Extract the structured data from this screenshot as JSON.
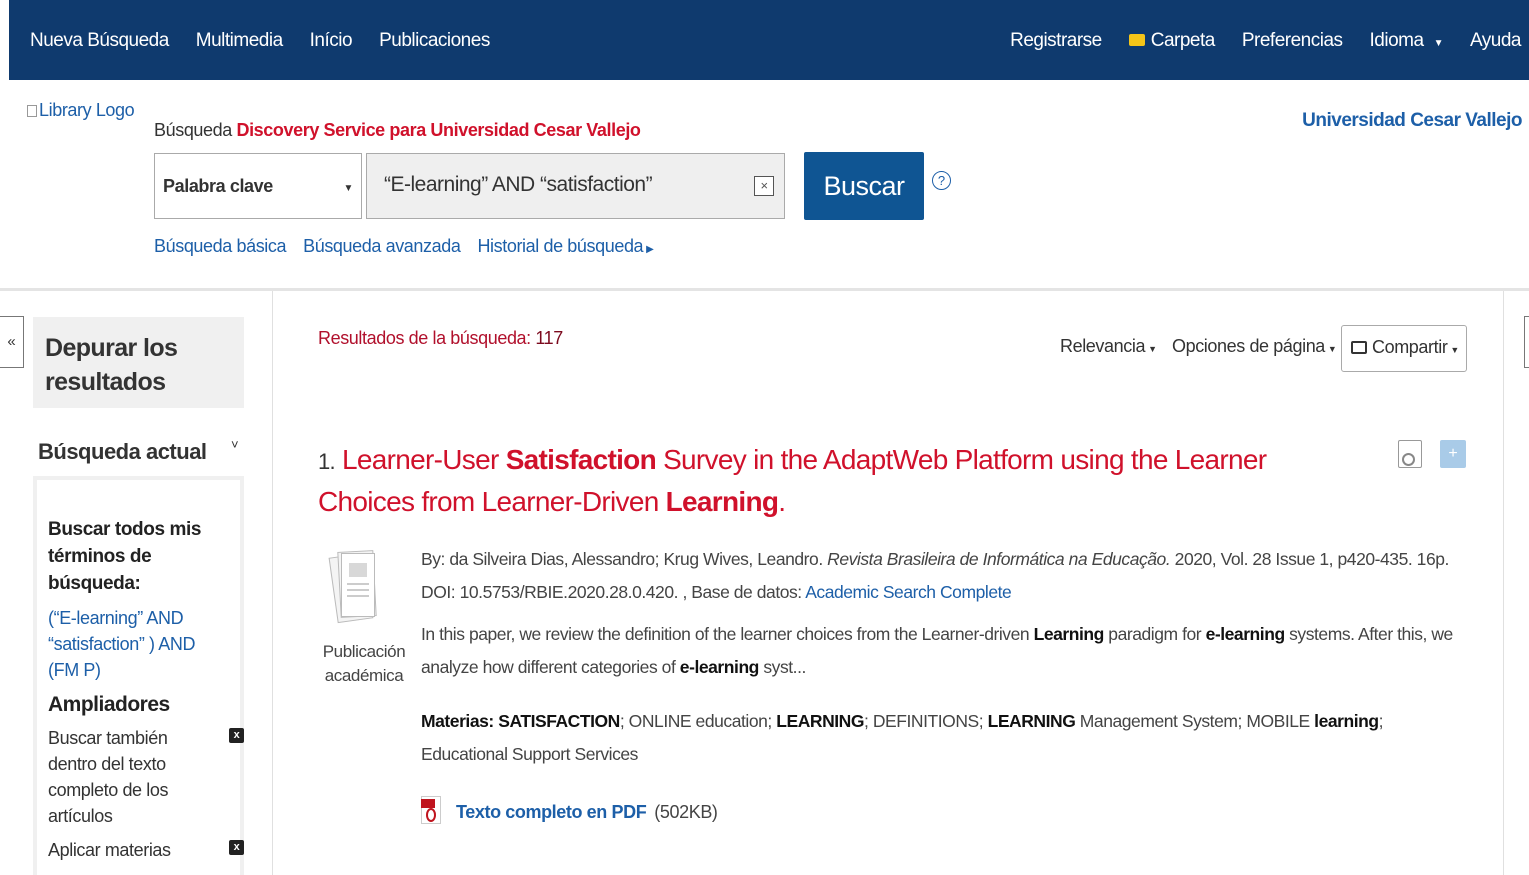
{
  "topnav": {
    "left": [
      "Nueva Búsqueda",
      "Multimedia",
      "Início",
      "Publicaciones"
    ],
    "register": "Registrarse",
    "folder": "Carpeta",
    "preferences": "Preferencias",
    "language": "Idioma",
    "help": "Ayuda"
  },
  "header": {
    "logo_alt": "Library Logo",
    "search_prefix": "Búsqueda",
    "search_service": "Discovery Service para Universidad Cesar Vallejo",
    "institution": "Universidad Cesar Vallejo",
    "field_select": "Palabra clave",
    "query": "“E-learning” AND “satisfaction”",
    "clear_icon": "×",
    "search_button": "Buscar",
    "help_icon": "?",
    "links": [
      "Búsqueda básica",
      "Búsqueda avanzada",
      "Historial de búsqueda"
    ]
  },
  "sidebar": {
    "collapse": "«",
    "refine_title": "Depurar los resultados",
    "current_search": "Búsqueda actual",
    "all_terms_heading": "Buscar todos mis términos de búsqueda:",
    "query_link": "(“E-learning” AND “satisfaction” ) AND (FM P)",
    "expanders_heading": "Ampliadores",
    "expanders": [
      {
        "label": "Buscar también dentro del texto completo de los artículos",
        "remove": "x"
      },
      {
        "label": "Aplicar materias",
        "remove": "x"
      }
    ]
  },
  "results": {
    "count_label": "Resultados de la búsqueda:",
    "count": "117",
    "sort": "Relevancia",
    "page_options": "Opciones de página",
    "share": "Compartir",
    "item": {
      "number": "1.",
      "title_parts": [
        {
          "text": "Learner-User ",
          "bold": false
        },
        {
          "text": "Satisfaction",
          "bold": true
        },
        {
          "text": " Survey in the AdaptWeb Platform using the Learner Choices from Learner-Driven ",
          "bold": false
        },
        {
          "text": "Learning",
          "bold": true
        },
        {
          "text": ".",
          "bold": false
        }
      ],
      "pub_type": "Publicación académica",
      "byline": "By: da Silveira Dias, Alessandro; Krug Wives, Leandro.",
      "journal": "Revista Brasileira de Informática na Educação.",
      "details": "2020, Vol. 28 Issue 1, p420-435. 16p. DOI: 10.5753/RBIE.2020.28.0.420. , Base de datos:",
      "database": "Academic Search Complete",
      "abstract_parts": [
        {
          "text": "In this paper, we review the definition of the learner choices from the Learner-driven ",
          "bold": false
        },
        {
          "text": "Learning",
          "bold": true
        },
        {
          "text": " paradigm for ",
          "bold": false
        },
        {
          "text": "e-learning",
          "bold": true
        },
        {
          "text": " systems. After this, we analyze how different categories of ",
          "bold": false
        },
        {
          "text": "e-learning",
          "bold": true
        },
        {
          "text": " syst...",
          "bold": false
        }
      ],
      "subjects_label": "Materias:",
      "subjects_parts": [
        {
          "text": "SATISFACTION",
          "bold": true
        },
        {
          "text": "; ONLINE education; ",
          "bold": false
        },
        {
          "text": "LEARNING",
          "bold": true
        },
        {
          "text": "; DEFINITIONS; ",
          "bold": false
        },
        {
          "text": "LEARNING",
          "bold": true
        },
        {
          "text": " Management System; MOBILE ",
          "bold": false
        },
        {
          "text": "learning",
          "bold": true
        },
        {
          "text": "; Educational Support Services",
          "bold": false
        }
      ],
      "pdf_label": "Texto completo en PDF",
      "pdf_size": "(502KB)"
    }
  },
  "colors": {
    "nav_bg": "#0f3a6e",
    "title_red": "#d0112b",
    "link_blue": "#1d5fa8",
    "button_blue": "#0f5593"
  },
  "icons": [
    "folder-icon",
    "dropdown-caret-icon",
    "clear-icon",
    "help-icon",
    "collapse-icon",
    "chevron-down-icon",
    "remove-icon",
    "share-icon",
    "preview-icon",
    "add-to-folder-icon",
    "document-icon",
    "pdf-icon"
  ]
}
